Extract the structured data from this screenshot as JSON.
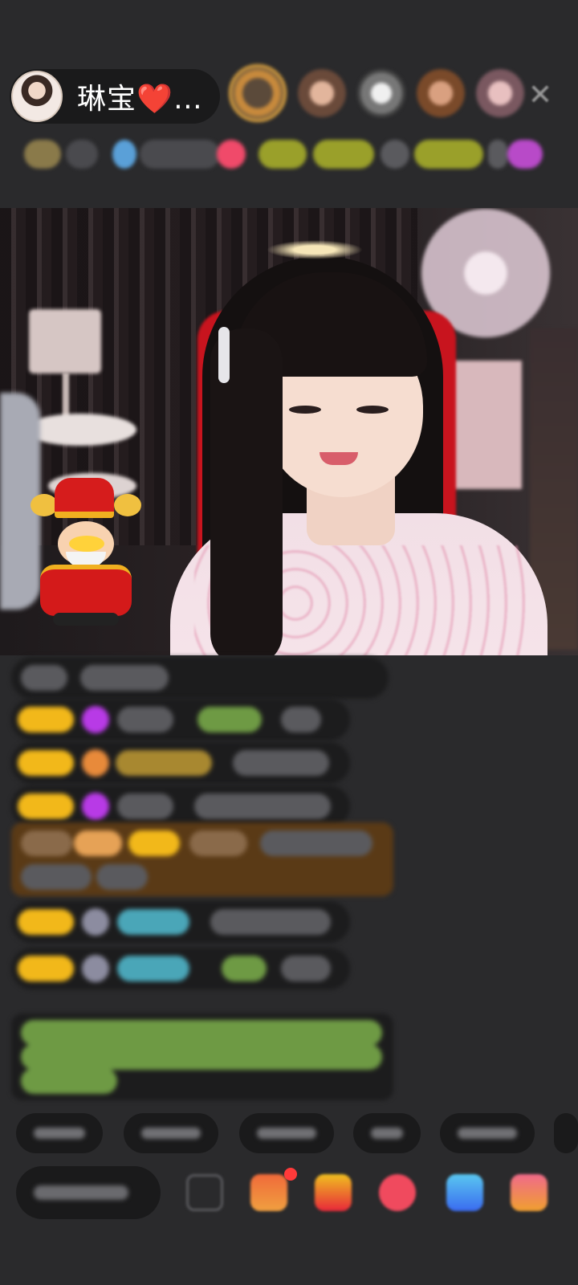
{
  "header": {
    "host_name": "琳宝❤️…",
    "close_glyph": "✕",
    "viewer_avatars": [
      "viewer-avatar-1",
      "viewer-avatar-2",
      "viewer-avatar-3",
      "viewer-avatar-4",
      "viewer-avatar-5"
    ]
  },
  "overlay": {
    "sticker": "caishen-god-of-wealth"
  },
  "chat": {
    "message_count_visible": 9
  },
  "quick_replies": {
    "count_visible": 6
  },
  "bottom_bar": {
    "icons": [
      "emoji-icon",
      "gift-box-icon",
      "red-envelope-icon",
      "heart-icon",
      "game-icon",
      "more-apps-icon"
    ]
  },
  "colors": {
    "background": "#2a2a2c",
    "gold_badge": "#f2b81a",
    "gift_highlight": "#5a3a16",
    "notice_text": "#6e9a44",
    "username_cyan": "#4aa6b8",
    "accent_red": "#ff3a3a"
  }
}
